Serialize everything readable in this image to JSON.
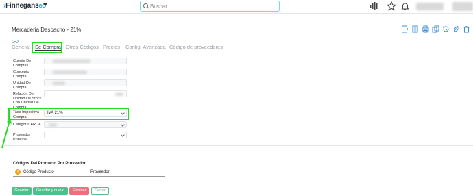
{
  "topbar": {
    "brand_name": "Finnegans",
    "brand_suffix": "GO",
    "search_placeholder": "Buscar..."
  },
  "page": {
    "title": "Mercaderia Despacho - 21%"
  },
  "tabs": [
    {
      "label": "General"
    },
    {
      "label": "Se Compra",
      "active": true
    },
    {
      "label": "Otros Códigos"
    },
    {
      "label": "Precios"
    },
    {
      "label": "Config. Avanzada"
    },
    {
      "label": "Código de proveedores"
    }
  ],
  "form": {
    "cuenta_label": "Cuenta De Compras",
    "concepto_label": "Concepto Compra",
    "unidad_label": "Unidad De Compra",
    "relacion_label": "Relación De Unidad De Stock Con Unidad De Compra",
    "tasa_label": "Tasa Impositiva Compra",
    "tasa_value": "IVA 21%",
    "categoria_label": "Categoría ARCA",
    "proveedor_label": "Proveedor Principal"
  },
  "section": {
    "title": "Códigos Del Producto Por Proveedor",
    "col1": "Código Producto",
    "col2": "Proveedor"
  },
  "buttons": {
    "save": "Guardar",
    "save_new": "Guardar y nuevo",
    "delete": "Eliminar",
    "close": "Cerrar"
  },
  "colors": {
    "accent": "#1da1f2",
    "save": "#4fc08d",
    "delete": "#ef6f7f",
    "highlight": "#22e01f"
  }
}
